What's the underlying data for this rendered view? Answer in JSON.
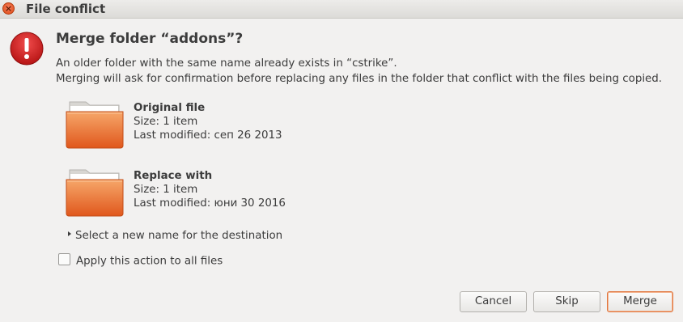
{
  "window": {
    "title": "File conflict",
    "close_icon": "close-icon",
    "accent": "#df4a16"
  },
  "dialog": {
    "heading": "Merge folder “addons”?",
    "desc_line1": "An older folder with the same name already exists in “cstrike”.",
    "desc_line2": "Merging will ask for confirmation before replacing any files in the folder that conflict with the files being copied.",
    "original": {
      "title": "Original file",
      "size": "Size: 1 item",
      "modified": "Last modified: сеп 26 2013"
    },
    "replace": {
      "title": "Replace with",
      "size": "Size: 1 item",
      "modified": "Last modified: юни 30 2016"
    },
    "expander_label": "Select a new name for the destination",
    "apply_all_label": "Apply this action to all files",
    "apply_all_checked": false
  },
  "buttons": {
    "cancel": "Cancel",
    "skip": "Skip",
    "merge": "Merge"
  }
}
